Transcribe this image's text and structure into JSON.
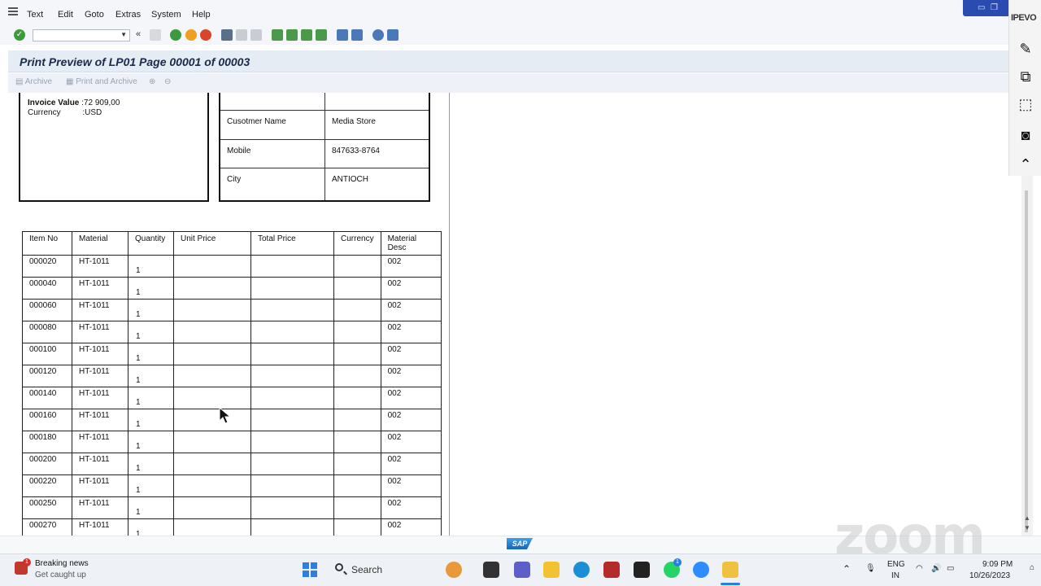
{
  "menubar": {
    "items": [
      "Text",
      "Edit",
      "Goto",
      "Extras",
      "System",
      "Help"
    ],
    "underline": [
      "T",
      "E",
      "G",
      "",
      "S",
      "H"
    ]
  },
  "toolbar": {
    "command_field_value": "",
    "enter_icon": "check-icon",
    "save_icon": "save-icon"
  },
  "title": "Print Preview of LP01 Page 00001 of 00003",
  "app_toolbar": {
    "archive_label": "Archive",
    "print_archive_label": "Print and Archive"
  },
  "invoice_box": {
    "lines": [
      {
        "label": "Invoice  Value",
        "value": ":72 909,00"
      },
      {
        "label": "Currency",
        "value": ":USD"
      }
    ]
  },
  "customer_box": {
    "rows": [
      {
        "label": "Cusotmer Name",
        "value": "Media Store"
      },
      {
        "label": "Mobile",
        "value": "847633-8764"
      },
      {
        "label": "City",
        "value": "ANTIOCH"
      }
    ]
  },
  "items_table": {
    "headers": [
      "Item No",
      "Material",
      "Quantity",
      "Unit Price",
      "Total Price",
      "Currency",
      "Material Desc"
    ],
    "rows": [
      {
        "item": "000020",
        "material": "HT-1011",
        "qty": "1",
        "desc": "002"
      },
      {
        "item": "000040",
        "material": "HT-1011",
        "qty": "1",
        "desc": "002"
      },
      {
        "item": "000060",
        "material": "HT-1011",
        "qty": "1",
        "desc": "002"
      },
      {
        "item": "000080",
        "material": "HT-1011",
        "qty": "1",
        "desc": "002"
      },
      {
        "item": "000100",
        "material": "HT-1011",
        "qty": "1",
        "desc": "002"
      },
      {
        "item": "000120",
        "material": "HT-1011",
        "qty": "1",
        "desc": "002"
      },
      {
        "item": "000140",
        "material": "HT-1011",
        "qty": "1",
        "desc": "002"
      },
      {
        "item": "000160",
        "material": "HT-1011",
        "qty": "1",
        "desc": "002"
      },
      {
        "item": "000180",
        "material": "HT-1011",
        "qty": "1",
        "desc": "002"
      },
      {
        "item": "000200",
        "material": "HT-1011",
        "qty": "1",
        "desc": "002"
      },
      {
        "item": "000220",
        "material": "HT-1011",
        "qty": "1",
        "desc": "002"
      },
      {
        "item": "000250",
        "material": "HT-1011",
        "qty": "1",
        "desc": "002"
      },
      {
        "item": "000270",
        "material": "HT-1011",
        "qty": "1",
        "desc": "002"
      }
    ]
  },
  "ipevo": {
    "brand": "IPEVO"
  },
  "status": {
    "sap_logo": "SAP"
  },
  "watermark": "zoom",
  "taskbar": {
    "news_title": "Breaking news",
    "news_sub": "Get caught up",
    "news_badge": "1",
    "search_label": "Search",
    "language": "ENG",
    "region": "IN",
    "time": "9:09 PM",
    "date": "10/26/2023",
    "whatsapp_badge": "1"
  },
  "colors": {
    "sap_blue": "#1466b8",
    "title_bg": "#e6ecf4",
    "toolbar_bg": "#f4f6fa"
  }
}
